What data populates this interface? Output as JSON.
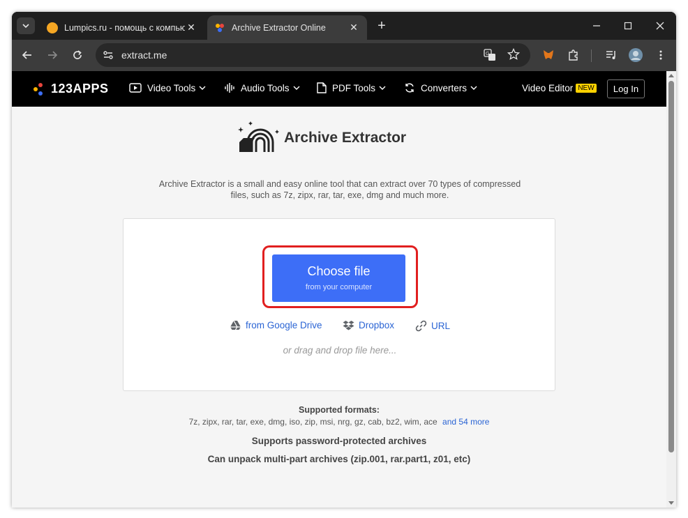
{
  "browser": {
    "tabs": [
      {
        "title": "Lumpics.ru - помощь с компьютер",
        "favicon_color": "#f5a623",
        "active": false
      },
      {
        "title": "Archive Extractor Online",
        "active": true
      }
    ],
    "address": "extract.me"
  },
  "site": {
    "logo_text": "123APPS",
    "nav": [
      {
        "label": "Video Tools"
      },
      {
        "label": "Audio Tools"
      },
      {
        "label": "PDF Tools"
      },
      {
        "label": "Converters"
      }
    ],
    "video_editor": "Video Editor",
    "new_badge": "NEW",
    "login": "Log In"
  },
  "main": {
    "title": "Archive Extractor",
    "description_line1": "Archive Extractor is a small and easy online tool that can extract over 70 types of compressed",
    "description_line2": "files, such as 7z, zipx, rar, tar, exe, dmg and much more.",
    "choose_file": "Choose file",
    "choose_file_sub": "from your computer",
    "sources": [
      {
        "label": "from Google Drive"
      },
      {
        "label": "Dropbox"
      },
      {
        "label": "URL"
      }
    ],
    "drag_drop": "or drag and drop file here...",
    "formats_title": "Supported formats:",
    "formats_list": "7z, zipx, rar, tar, exe, dmg, iso, zip, msi, nrg, gz, cab, bz2, wim, ace",
    "formats_more": "and 54 more",
    "feature_1": "Supports password-protected archives",
    "feature_2": "Can unpack multi-part archives (zip.001, rar.part1, z01, etc)"
  },
  "colors": {
    "primary_button": "#3d6ef7",
    "link": "#2a64d4",
    "highlight": "#e11f1f",
    "badge": "#ffd200"
  }
}
